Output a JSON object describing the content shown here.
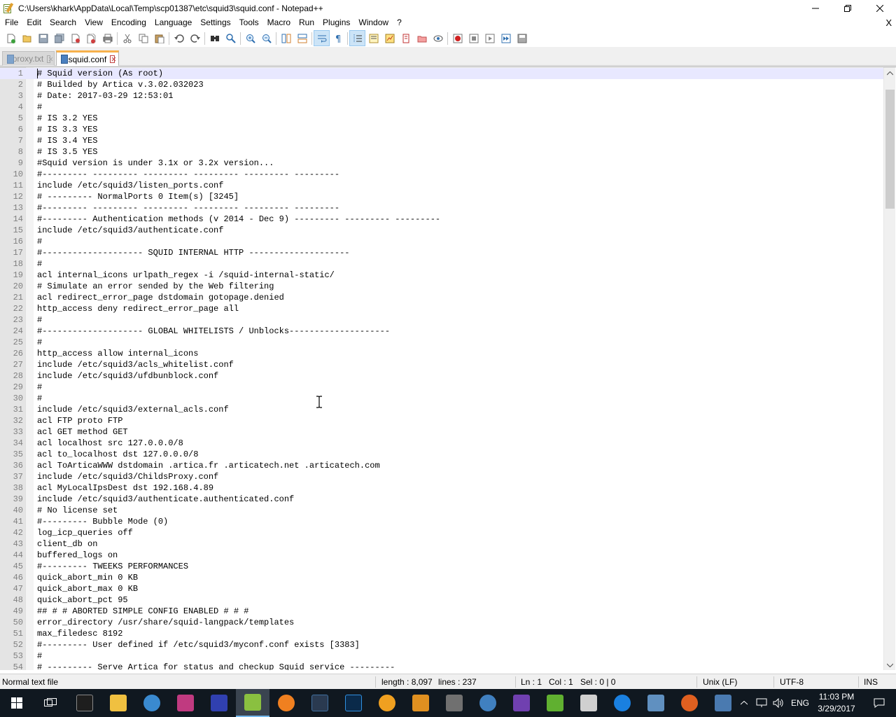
{
  "window": {
    "title": "C:\\Users\\khark\\AppData\\Local\\Temp\\scp01387\\etc\\squid3\\squid.conf - Notepad++"
  },
  "menu": {
    "items": [
      "File",
      "Edit",
      "Search",
      "View",
      "Encoding",
      "Language",
      "Settings",
      "Tools",
      "Macro",
      "Run",
      "Plugins",
      "Window",
      "?"
    ],
    "close_glyph": "X"
  },
  "toolbar": {
    "icons": [
      "new-file-icon",
      "open-file-icon",
      "save-icon",
      "save-all-icon",
      "close-icon",
      "close-all-icon",
      "print-icon",
      "cut-icon",
      "copy-icon",
      "paste-icon",
      "undo-icon",
      "redo-icon",
      "find-icon",
      "replace-icon",
      "zoom-in-icon",
      "zoom-out-icon",
      "sync-vertical-icon",
      "sync-horizontal-icon",
      "word-wrap-icon",
      "show-all-characters-icon",
      "indent-guide-icon",
      "function-list-icon",
      "document-map-icon",
      "folder-as-workspace-icon",
      "monitoring-icon",
      "record-macro-icon",
      "stop-macro-icon",
      "play-macro-icon",
      "run-macro-multiple-icon",
      "save-macro-icon"
    ]
  },
  "tabs": [
    {
      "label": "proxy.txt",
      "active": false
    },
    {
      "label": "squid.conf",
      "active": true
    }
  ],
  "editor": {
    "lines": [
      "# Squid version (As root)",
      "# Builded by Artica v.3.02.032023",
      "# Date: 2017-03-29 12:53:01",
      "#",
      "# IS 3.2 YES",
      "# IS 3.3 YES",
      "# IS 3.4 YES",
      "# IS 3.5 YES",
      "#Squid version is under 3.1x or 3.2x version...",
      "#--------- --------- --------- --------- --------- ---------",
      "include /etc/squid3/listen_ports.conf",
      "# --------- NormalPorts 0 Item(s) [3245]",
      "#--------- --------- --------- --------- --------- ---------",
      "#--------- Authentication methods (v 2014 - Dec 9) --------- --------- ---------",
      "include /etc/squid3/authenticate.conf",
      "#",
      "#-------------------- SQUID INTERNAL HTTP --------------------",
      "#",
      "acl internal_icons urlpath_regex -i /squid-internal-static/",
      "# Simulate an error sended by the Web filtering",
      "acl redirect_error_page dstdomain gotopage.denied",
      "http_access deny redirect_error_page all",
      "#",
      "#-------------------- GLOBAL WHITELISTS / Unblocks--------------------",
      "#",
      "http_access allow internal_icons",
      "include /etc/squid3/acls_whitelist.conf",
      "include /etc/squid3/ufdbunblock.conf",
      "#",
      "#",
      "include /etc/squid3/external_acls.conf",
      "acl FTP proto FTP",
      "acl GET method GET",
      "acl localhost src 127.0.0.0/8",
      "acl to_localhost dst 127.0.0.0/8",
      "acl ToArticaWWW dstdomain .artica.fr .articatech.net .articatech.com",
      "include /etc/squid3/ChildsProxy.conf",
      "acl MyLocalIpsDest dst 192.168.4.89",
      "include /etc/squid3/authenticate.authenticated.conf",
      "# No license set",
      "#--------- Bubble Mode (0)",
      "log_icp_queries off",
      "client_db on",
      "buffered_logs on",
      "#--------- TWEEKS PERFORMANCES",
      "quick_abort_min 0 KB",
      "quick_abort_max 0 KB",
      "quick_abort_pct 95",
      "## # # ABORTED SIMPLE CONFIG ENABLED # # #",
      "error_directory /usr/share/squid-langpack/templates",
      "max_filedesc 8192",
      "#--------- User defined if /etc/squid3/myconf.conf exists [3383]",
      "#",
      "# --------- Serve Artica for status and checkup Squid service ---------"
    ]
  },
  "status": {
    "file_type": "Normal text file",
    "length": "length : 8,097",
    "lines": "lines : 237",
    "ln": "Ln : 1",
    "col": "Col : 1",
    "sel": "Sel : 0 | 0",
    "eol": "Unix (LF)",
    "encoding": "UTF-8",
    "mode": "INS"
  },
  "taskbar": {
    "apps": [
      "start-icon",
      "task-view-icon",
      "terminal-icon",
      "file-explorer-icon",
      "app-icon-1",
      "app-icon-2",
      "app-icon-3",
      "notepad-plus-plus-icon",
      "blender-icon",
      "rstudio-icon",
      "photoshop-icon",
      "app-icon-4",
      "app-icon-5",
      "app-icon-6",
      "app-icon-7",
      "visual-studio-icon",
      "app-icon-8",
      "calendar-icon",
      "teamviewer-icon",
      "app-icon-9",
      "firefox-icon",
      "app-icon-10"
    ],
    "tray_lang": "ENG",
    "time": "11:03 PM",
    "date": "3/29/2017"
  }
}
